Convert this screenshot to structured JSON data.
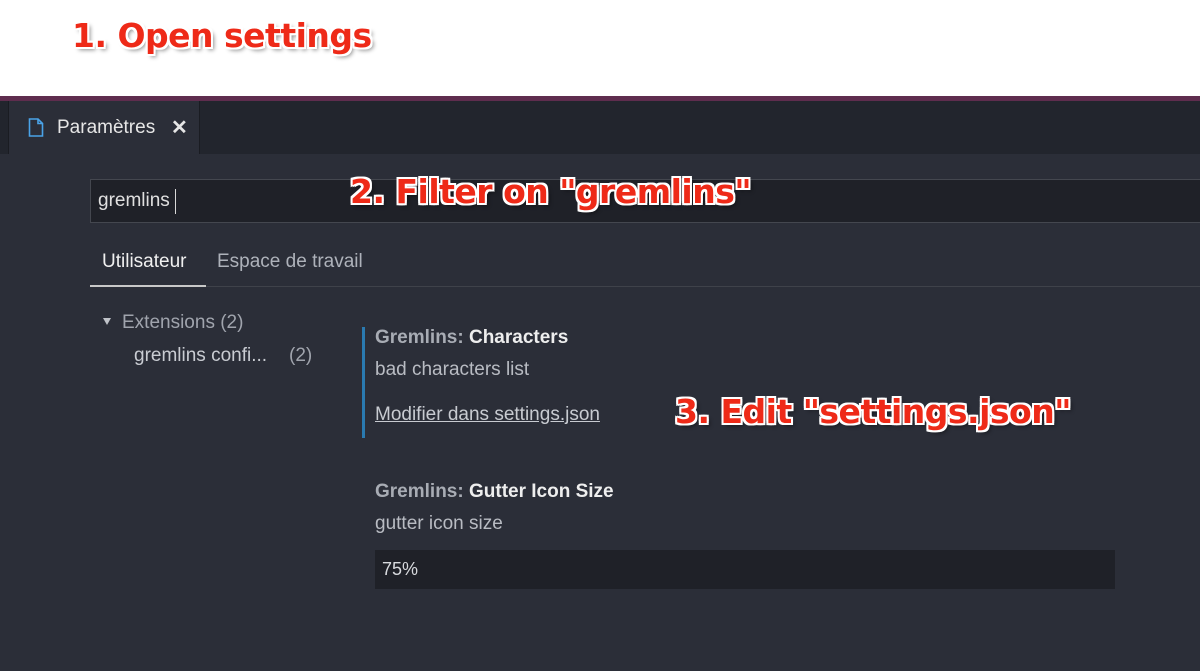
{
  "annotations": {
    "step1": "1. Open settings",
    "step2": "2. Filter on \"gremlins\"",
    "step3": "3. Edit \"settings.json\""
  },
  "tab": {
    "label": "Paramètres",
    "close": "✕",
    "icon": "file-icon"
  },
  "search": {
    "value": "gremlins"
  },
  "scope_tabs": {
    "user": "Utilisateur",
    "workspace": "Espace de travail"
  },
  "tree": {
    "extensions_label": "Extensions (2)",
    "child_label": "gremlins confi...",
    "child_count": "(2)"
  },
  "settings": [
    {
      "category": "Gremlins: ",
      "name": "Characters",
      "description": "bad characters list",
      "link": "Modifier dans settings.json"
    },
    {
      "category": "Gremlins: ",
      "name": "Gutter Icon Size",
      "description": "gutter icon size",
      "value": "75%"
    }
  ],
  "colors": {
    "annotation": "#ee2a18",
    "editor_bg": "#2b2e38",
    "accent_border": "#5f2d4e",
    "modified_bar": "#2a7ab0"
  }
}
